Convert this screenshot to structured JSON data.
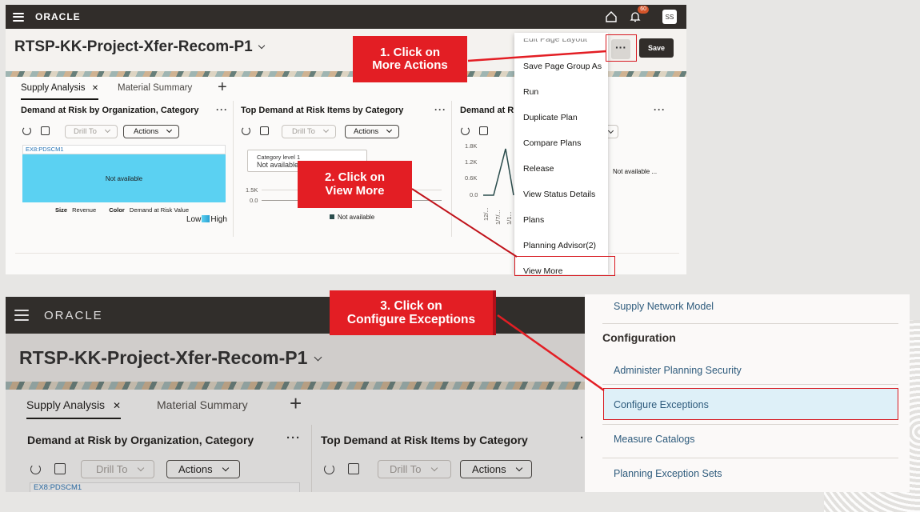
{
  "header": {
    "logo": "ORACLE",
    "notifications_count": "60",
    "user_initials": "SS"
  },
  "page": {
    "title": "RTSP-KK-Project-Xfer-Recom-P1",
    "save_label": "Save",
    "more_label": "···"
  },
  "tabs": [
    {
      "label": "Supply Analysis",
      "close": "✕",
      "active": true
    },
    {
      "label": "Material Summary",
      "active": false
    }
  ],
  "add_tab": "+",
  "cards": {
    "demand_risk_org": {
      "title": "Demand at Risk by Organization, Category",
      "drill_to": "Drill To",
      "actions": "Actions",
      "treemap_header": "EX8:PDSCM1",
      "treemap_text": "Not available",
      "size_label": "Size",
      "size_value": "Revenue",
      "color_label": "Color",
      "color_value": "Demand at Risk Value",
      "low": "Low",
      "high": "High"
    },
    "top_demand_risk": {
      "title": "Top Demand at Risk Items by Category",
      "drill_to": "Drill To",
      "actions": "Actions",
      "category_label": "Category level 1",
      "category_value": "Not available",
      "y_ticks": [
        "1.5K",
        "0.0"
      ],
      "legend": "Not available"
    },
    "demand_risk_3": {
      "title": "Demand at Ri",
      "y_ticks": [
        "1.8K",
        "1.2K",
        "0.6K",
        "0.0"
      ],
      "x_ticks": [
        "12/...",
        "1/7/...",
        "1/1..."
      ],
      "legend_partial": "Not available ..."
    }
  },
  "more_actions_menu": [
    "Edit Page Layout",
    "Save Page Group As",
    "Run",
    "Duplicate Plan",
    "Compare Plans",
    "Release",
    "View Status Details",
    "Plans",
    "Planning Advisor(2)",
    "View More"
  ],
  "callouts": {
    "step1": [
      "1. Click on",
      "More Actions"
    ],
    "step2": [
      "2. Click on",
      "View More"
    ],
    "step3": [
      "3. Click on",
      "Configure Exceptions"
    ]
  },
  "view_more_menu": {
    "top_item": "Supply Network Model",
    "section": "Configuration",
    "items": [
      "Administer Planning Security",
      "Configure Exceptions",
      "Measure Catalogs",
      "Planning Exception Sets"
    ]
  },
  "partial_bottom_text": "EX8:PDSCM1",
  "colors": {
    "callout": "#e31e24",
    "header": "#312d2a",
    "treemap": "#5bd1f2",
    "highlight": "#def0f8",
    "link": "#2e5b7c"
  }
}
